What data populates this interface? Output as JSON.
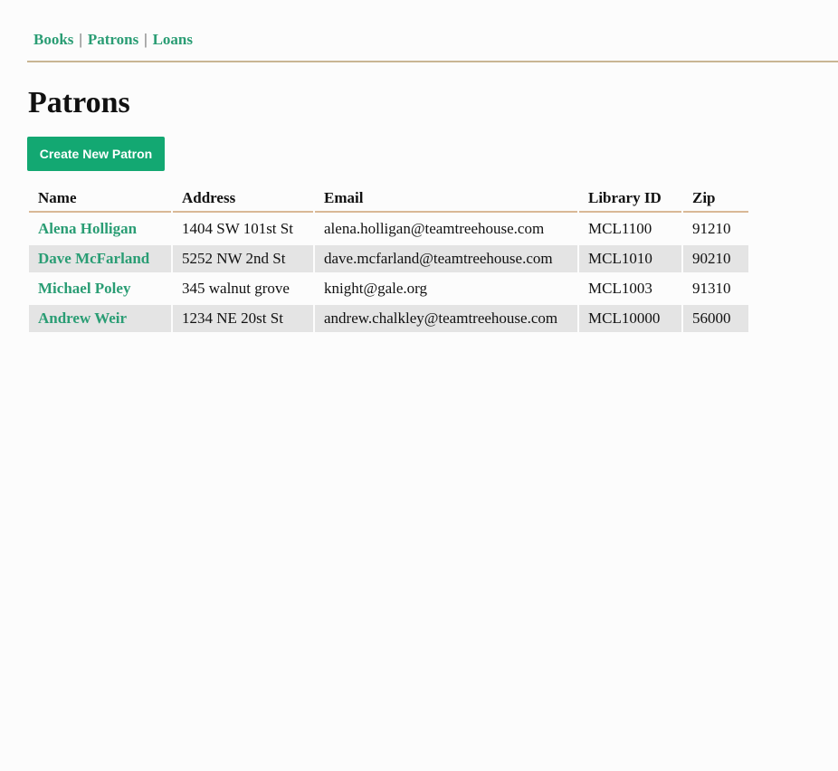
{
  "nav": {
    "items": [
      {
        "label": "Books"
      },
      {
        "label": "Patrons"
      },
      {
        "label": "Loans"
      }
    ],
    "separator": "|"
  },
  "page": {
    "title": "Patrons"
  },
  "actions": {
    "create_label": "Create New Patron"
  },
  "table": {
    "headers": [
      "Name",
      "Address",
      "Email",
      "Library ID",
      "Zip"
    ],
    "rows": [
      {
        "name": "Alena Holligan",
        "address": "1404 SW 101st St",
        "email": "alena.holligan@teamtreehouse.com",
        "library_id": "MCL1100",
        "zip": "91210"
      },
      {
        "name": "Dave McFarland",
        "address": "5252 NW 2nd St",
        "email": "dave.mcfarland@teamtreehouse.com",
        "library_id": "MCL1010",
        "zip": "90210"
      },
      {
        "name": "Michael Poley",
        "address": "345 walnut grove",
        "email": "knight@gale.org",
        "library_id": "MCL1003",
        "zip": "91310"
      },
      {
        "name": "Andrew Weir",
        "address": "1234 NE 20st St",
        "email": "andrew.chalkley@teamtreehouse.com",
        "library_id": "MCL10000",
        "zip": "56000"
      }
    ]
  },
  "colors": {
    "accent": "#2a9d74",
    "button": "#13a872",
    "rule": "#c9b594",
    "stripe": "#e4e4e4"
  }
}
